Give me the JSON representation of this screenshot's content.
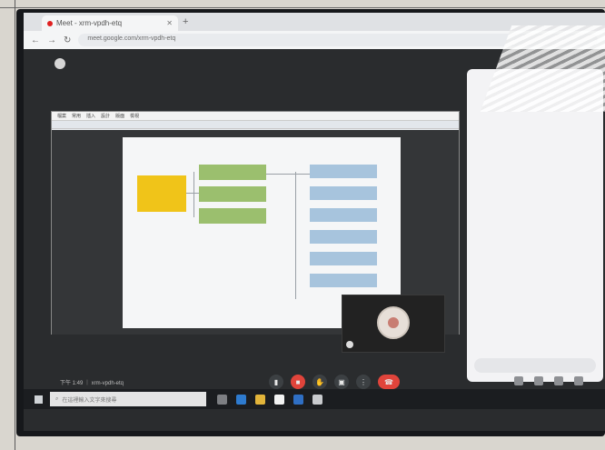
{
  "browser": {
    "tab_title": "Meet - xrm-vpdh-etq",
    "omnibox_url": "meet.google.com/xrm-vpdh-etq"
  },
  "meet": {
    "org_name": "",
    "time_and_code": "下午 1:49  ｜  xrm-vpdh-etq"
  },
  "document": {
    "menus": [
      "檔案",
      "常用",
      "插入",
      "設計",
      "版面",
      "檢視"
    ],
    "page_title": "",
    "root_node": "",
    "level2": [
      "",
      "",
      ""
    ],
    "level3": [
      "",
      "",
      "",
      "",
      "",
      ""
    ]
  },
  "panel": {
    "title": "",
    "subtitle": "",
    "message1": "",
    "message2": "",
    "link": "",
    "message3": "",
    "message4": "",
    "input_placeholder": ""
  },
  "taskbar": {
    "search_placeholder": "在這裡輸入文字來搜尋",
    "tray_text": ""
  },
  "colors": {
    "root_node": "#f0c419",
    "level2_node": "#9bbf6e",
    "level3_node": "#a7c4dd",
    "hangup": "#e0443b"
  },
  "icons": {
    "meet_controls": [
      "mic-icon",
      "camera-off-icon",
      "raise-hand-icon",
      "present-icon",
      "more-options-icon",
      "hangup-icon"
    ]
  }
}
